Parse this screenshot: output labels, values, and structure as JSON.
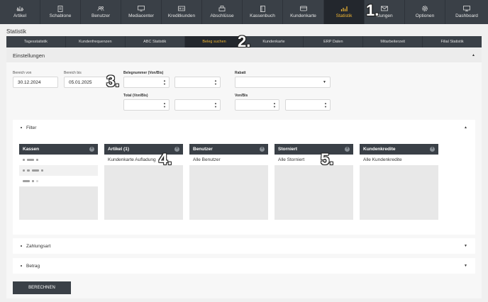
{
  "nav": {
    "items": [
      {
        "label": "Artikel",
        "icon": "scale-icon"
      },
      {
        "label": "Schablone",
        "icon": "document-icon"
      },
      {
        "label": "Benutzer",
        "icon": "users-icon"
      },
      {
        "label": "Mediacenter",
        "icon": "monitor-icon"
      },
      {
        "label": "Kreditkunden",
        "icon": "id-card-icon"
      },
      {
        "label": "Abschlüsse",
        "icon": "register-icon"
      },
      {
        "label": "Kassenbuch",
        "icon": "book-icon"
      },
      {
        "label": "Kundenkarte",
        "icon": "card-icon"
      },
      {
        "label": "Statistik",
        "icon": "bar-chart-icon"
      },
      {
        "label": "ldungen",
        "icon": "envelope-icon"
      },
      {
        "label": "Optionen",
        "icon": "gear-icon"
      },
      {
        "label": "Dashboard",
        "icon": "screen-icon"
      }
    ],
    "active_index": 8,
    "accent": "#f2b733",
    "background": "#3a4047"
  },
  "page_title": "Statistik",
  "subtabs": {
    "items": [
      "Tagesstatistik",
      "Kundenfrequenzen",
      "ABC Statistik",
      "Beleg suchen",
      "Kundenkarte",
      "ERP Daten",
      "Mitarbeiterzeit",
      "Filial Statistik"
    ],
    "active_index": 3
  },
  "settings": {
    "title": "Einstellungen",
    "bereich_von_label": "Bereich von",
    "bereich_von_value": "30.12.2024",
    "bereich_bis_label": "Bereich bis",
    "bereich_bis_value": "05.01.2025",
    "belegnummer_label": "Belegnummer (Von/Bis)",
    "total_label": "Total (Von/Bis)",
    "rabatt_label": "Rabatt",
    "vonbis_label": "Von/Bis"
  },
  "filter": {
    "title": "Filter",
    "boxes": [
      {
        "title": "Kassen",
        "rows": []
      },
      {
        "title": "Artikel (1)",
        "rows": [
          "Kundenkarte Aufladung"
        ]
      },
      {
        "title": "Benutzer",
        "rows": [
          "Alle Benutzer"
        ]
      },
      {
        "title": "Storniert",
        "rows": [
          "Alle Storniert"
        ]
      },
      {
        "title": "Kundenkredite",
        "rows": [
          "Alle Kundenkredite"
        ]
      }
    ]
  },
  "sections": {
    "zahlungsart": "Zahlungsart",
    "betrag": "Betrag"
  },
  "button": {
    "label": "BERECHNEN"
  },
  "markers": [
    "1.",
    "2.",
    "3.",
    "4.",
    "5."
  ]
}
